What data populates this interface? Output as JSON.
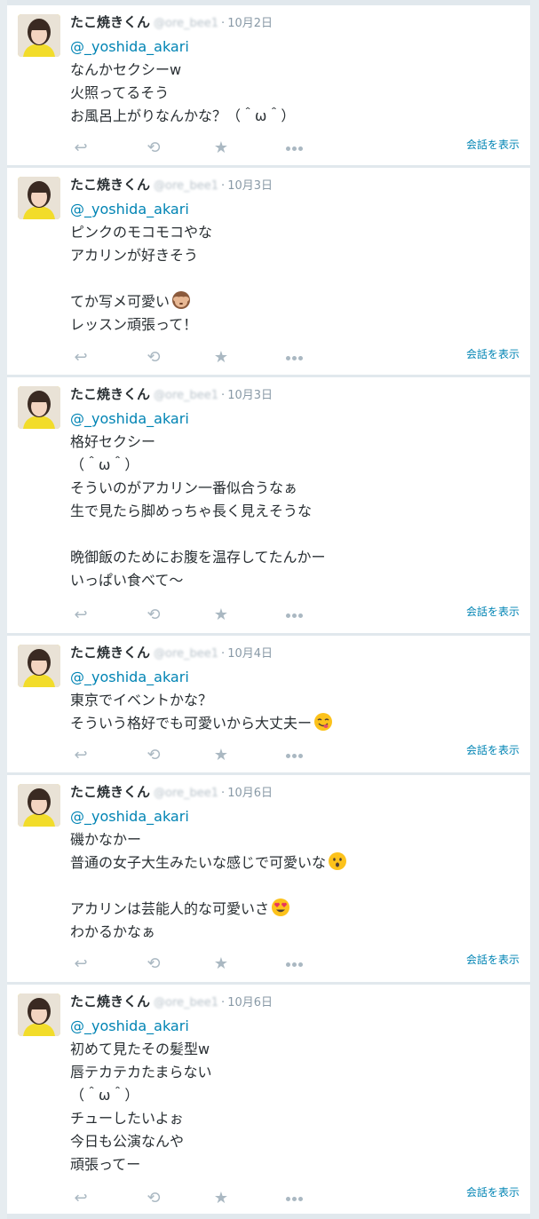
{
  "tweets": [
    {
      "name": "たこ焼きくん",
      "handle": "@ore_bee1",
      "date": "10月2日",
      "reply_to": "@_yoshida_akari",
      "lines": [
        "なんかセクシーw",
        "火照ってるそう",
        "お風呂上がりなんかな？（＾ω＾）"
      ],
      "conversation": "会話を表示"
    },
    {
      "name": "たこ焼きくん",
      "handle": "@ore_bee1",
      "date": "10月3日",
      "reply_to": "@_yoshida_akari",
      "lines": [
        "ピンクのモコモコやな",
        "アカリンが好きそう",
        "",
        "てか写メ可愛い",
        "レッスン頑張って！"
      ],
      "emoji": {
        "line": 3,
        "name": "see-no-evil-monkey-emoji"
      },
      "conversation": "会話を表示"
    },
    {
      "name": "たこ焼きくん",
      "handle": "@ore_bee1",
      "date": "10月3日",
      "reply_to": "@_yoshida_akari",
      "lines": [
        "格好セクシー",
        "（＾ω＾）",
        "そういのがアカリン一番似合うなぁ",
        "生で見たら脚めっちゃ長く見えそうな",
        "",
        "晩御飯のためにお腹を温存してたんかー",
        "いっぱい食べて〜"
      ],
      "conversation": "会話を表示"
    },
    {
      "name": "たこ焼きくん",
      "handle": "@ore_bee1",
      "date": "10月4日",
      "reply_to": "@_yoshida_akari",
      "lines": [
        "東京でイベントかな？",
        "そういう格好でも可愛いから大丈夫ー"
      ],
      "emoji": {
        "line": 1,
        "name": "yum-face-emoji"
      },
      "conversation": "会話を表示"
    },
    {
      "name": "たこ焼きくん",
      "handle": "@ore_bee1",
      "date": "10月6日",
      "reply_to": "@_yoshida_akari",
      "lines": [
        "磯かなかー",
        "普通の女子大生みたいな感じで可愛いな",
        "",
        "アカリンは芸能人的な可愛いさ",
        "わかるかなぁ"
      ],
      "emoji2": [
        {
          "line": 1,
          "name": "surprised-face-emoji"
        },
        {
          "line": 3,
          "name": "heart-eyes-emoji"
        }
      ],
      "conversation": "会話を表示"
    },
    {
      "name": "たこ焼きくん",
      "handle": "@ore_bee1",
      "date": "10月6日",
      "reply_to": "@_yoshida_akari",
      "lines": [
        "初めて見たその髪型w",
        "唇テカテカたまらない",
        "（＾ω＾）",
        "チューしたいよぉ",
        "今日も公演なんや",
        "頑張ってー"
      ],
      "conversation": "会話を表示"
    }
  ],
  "icons": {
    "reply": "reply-icon",
    "retweet": "retweet-icon",
    "favorite": "star-icon",
    "more": "more-icon"
  },
  "colors": {
    "link": "#0084b4",
    "text": "#292f33",
    "muted": "#8899a6",
    "action": "#aab8c2"
  }
}
